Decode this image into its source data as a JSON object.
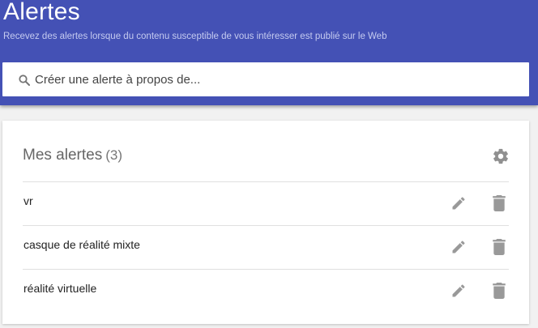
{
  "header": {
    "title": "Alertes",
    "subtitle": "Recevez des alertes lorsque du contenu susceptible de vous intéresser est publié sur le Web"
  },
  "search": {
    "placeholder": "Créer une alerte à propos de...",
    "icon": "search-icon"
  },
  "alerts_card": {
    "title": "Mes alertes",
    "count": "(3)",
    "settings_icon": "gear-icon",
    "items": [
      {
        "label": "vr",
        "edit_icon": "pencil-icon",
        "delete_icon": "trash-icon"
      },
      {
        "label": "casque de réalité mixte",
        "edit_icon": "pencil-icon",
        "delete_icon": "trash-icon"
      },
      {
        "label": "réalité virtuelle",
        "edit_icon": "pencil-icon",
        "delete_icon": "trash-icon"
      }
    ]
  },
  "colors": {
    "header_bg": "#4451b5",
    "page_bg": "#f1f1f1",
    "icon_gray": "#999999"
  }
}
